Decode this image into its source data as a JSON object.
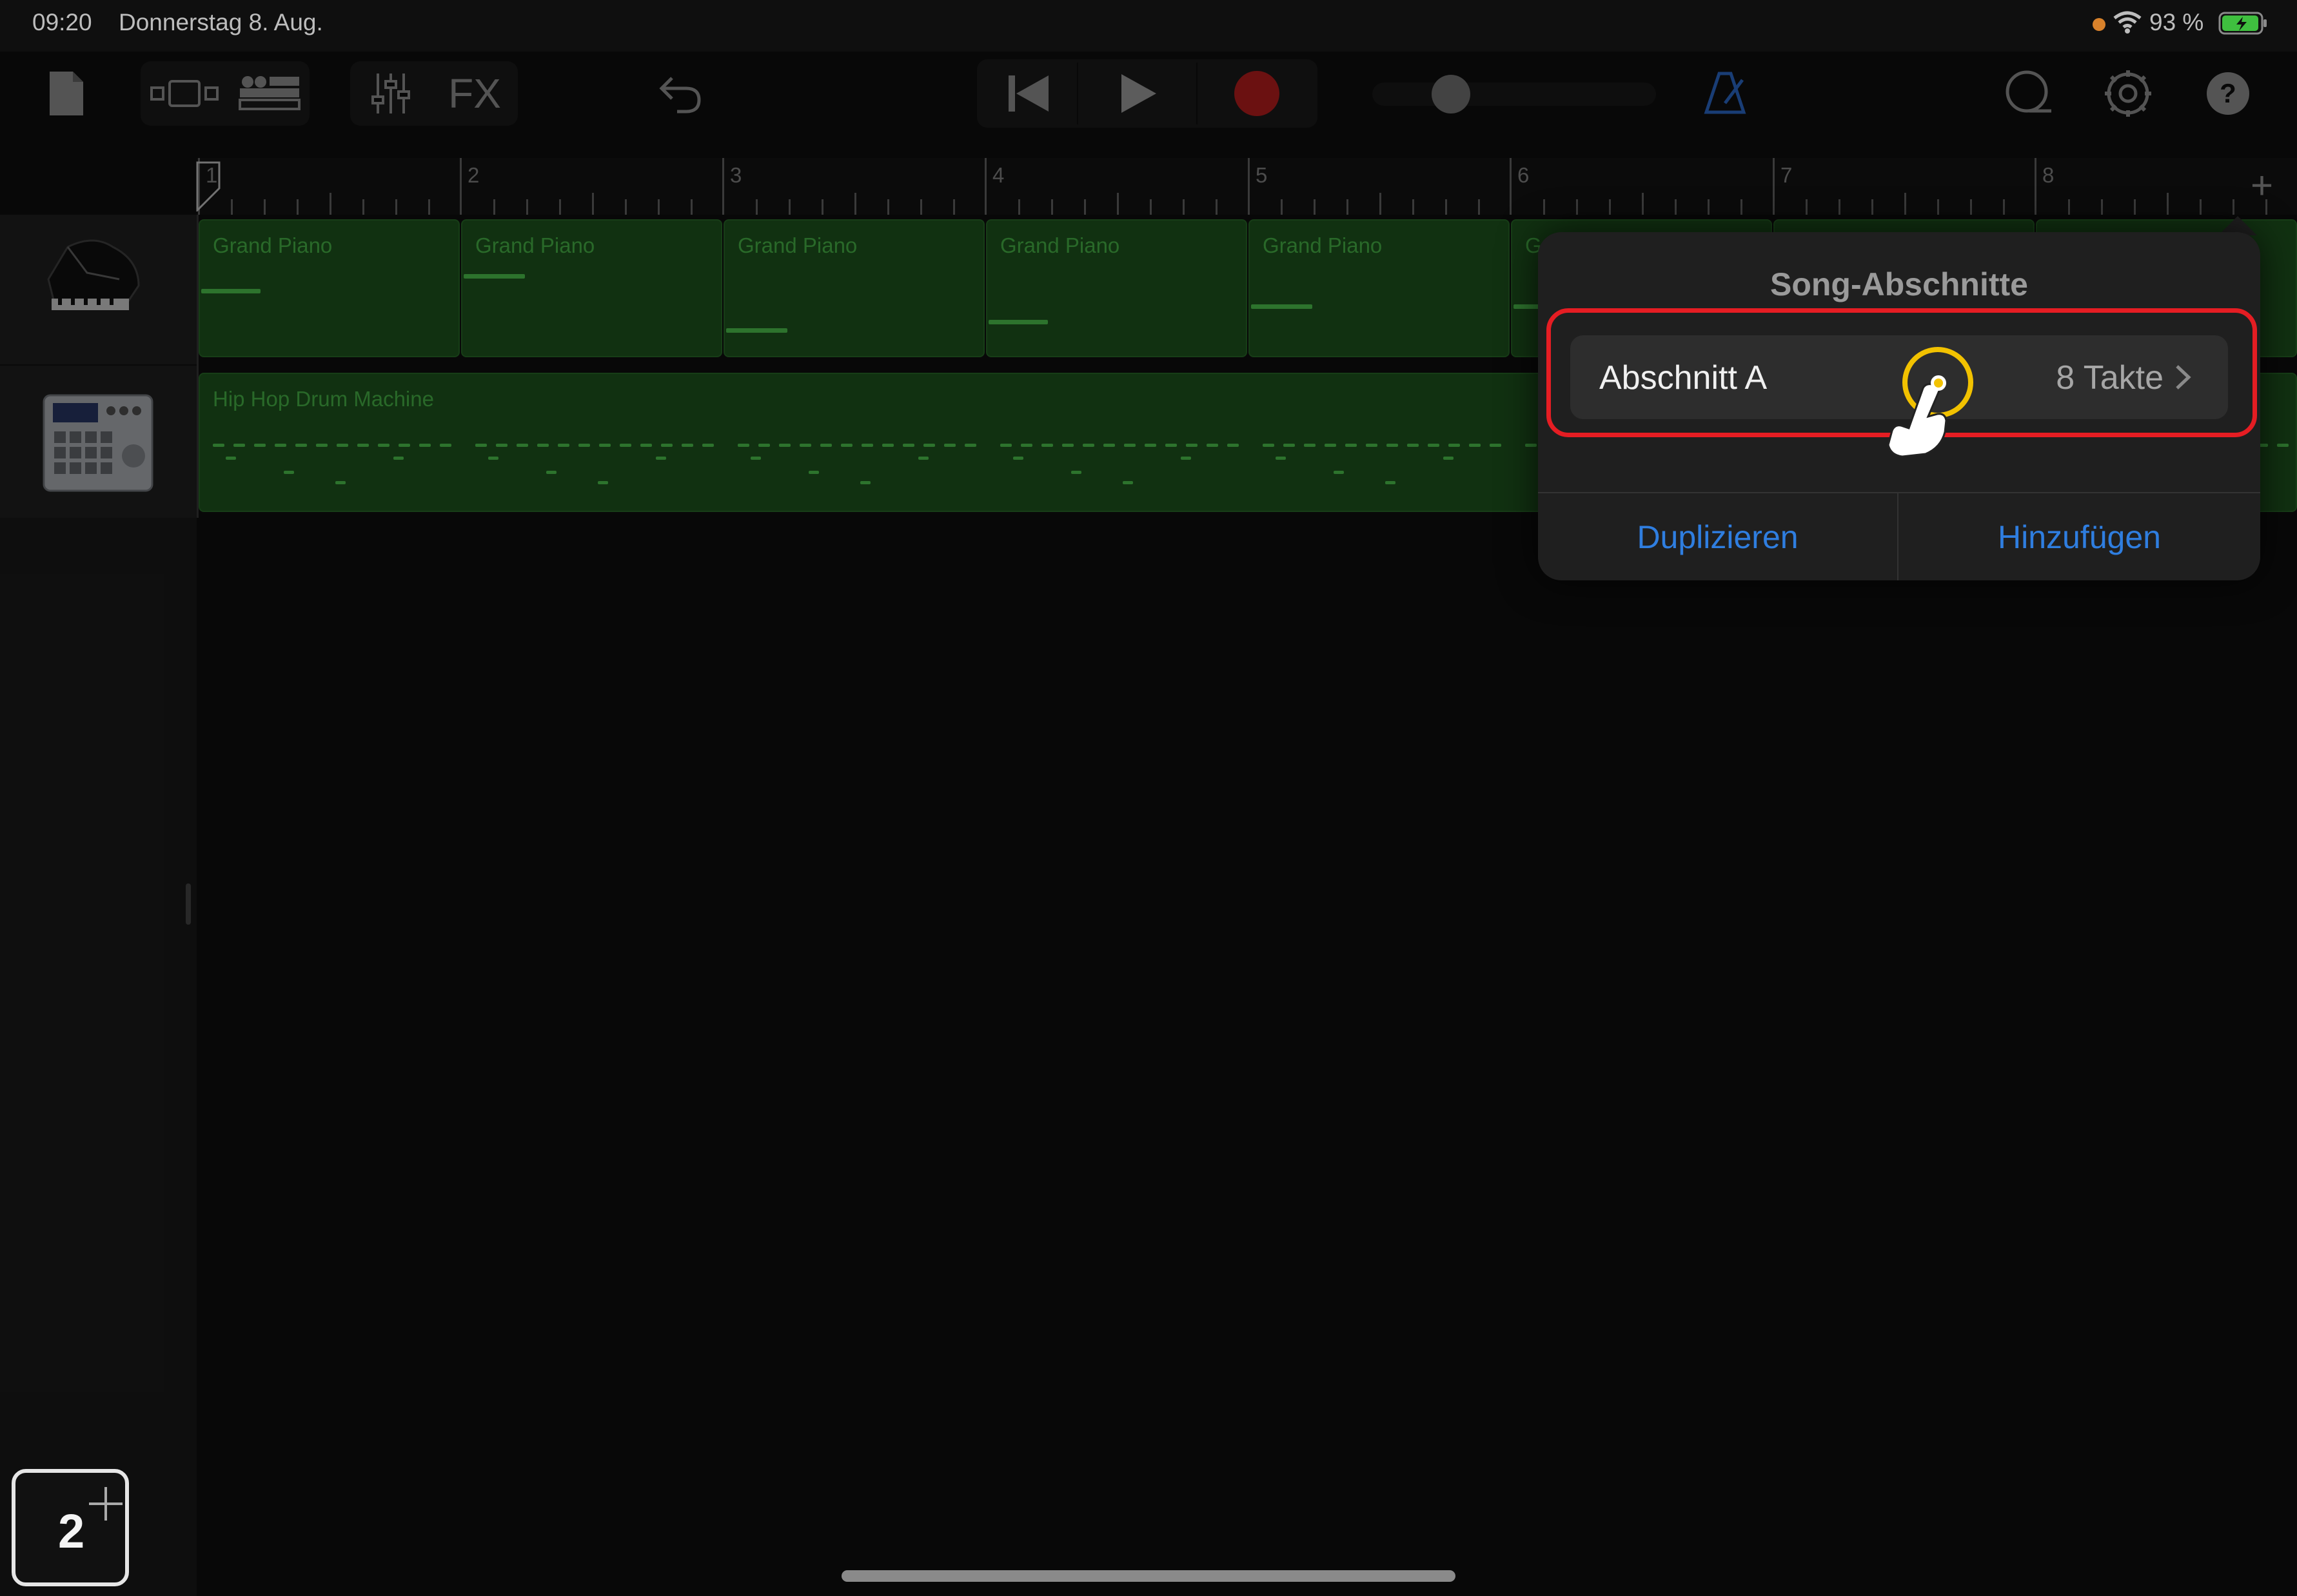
{
  "status_bar": {
    "time": "09:20",
    "date": "Donnerstag 8. Aug.",
    "battery": "93 %",
    "icons": [
      "privacy-dot",
      "wifi-icon",
      "battery-icon"
    ]
  },
  "toolbar": {
    "icons": [
      "document-icon",
      "track-view-icon",
      "browser-icon",
      "mixer-icon",
      "undo-icon",
      "rewind-icon",
      "play-icon",
      "record-icon",
      "metronome-icon",
      "loop-icon",
      "settings-icon",
      "help-icon"
    ],
    "fx_label": "FX",
    "record_color": "#c42020",
    "metronome_color": "#2f6fd6"
  },
  "ruler": {
    "bars": [
      "1",
      "2",
      "3",
      "4",
      "5",
      "6",
      "7",
      "8"
    ],
    "add_label": "+"
  },
  "tracks": [
    {
      "name": "Grand Piano",
      "icon": "grand-piano-icon",
      "regions": [
        "Grand Piano",
        "Grand Piano",
        "Grand Piano",
        "Grand Piano",
        "Grand Piano",
        "Gr"
      ]
    },
    {
      "name": "Hip Hop Drum Machine",
      "icon": "drum-machine-icon",
      "regions": [
        "Hip Hop Drum Machine"
      ]
    }
  ],
  "popover": {
    "title": "Song-Abschnitte",
    "section": {
      "name": "Abschnitt A",
      "length": "8 Takte"
    },
    "duplicate_label": "Duplizieren",
    "add_label": "Hinzufügen",
    "highlight_color": "#e51d23",
    "tap_color": "#f2c200"
  },
  "step_badge": {
    "number": "2"
  }
}
